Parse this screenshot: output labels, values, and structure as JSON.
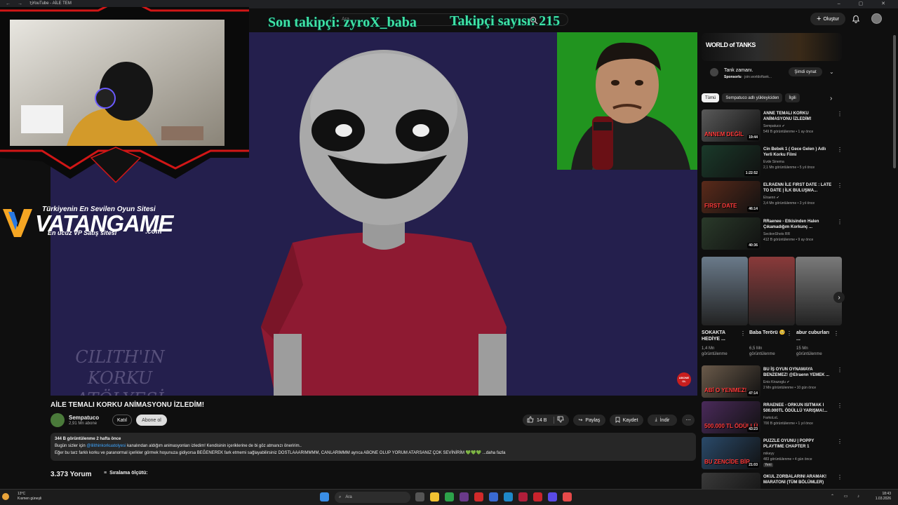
{
  "browser": {
    "tab_title": "YouTube - AİLE TEM",
    "nav_glyphs": "← → ↻",
    "window_glyphs": "– ▢ ✕"
  },
  "header": {
    "search_placeholder": "Ara",
    "create_label": "Oluştur"
  },
  "overlay": {
    "last_follower": "Son takipçi: zyroX_baba",
    "follower_count": "Takipçi sayısı: 215",
    "watermark_line1": "CILITH'IN KORKU",
    "watermark_line2": "ATÖLYESİ",
    "abone_label": "ABONE OL"
  },
  "sponsor": {
    "tagline": "Türkiyenin En Sevilen Oyun Sitesi",
    "name_part1": "VATAN",
    "name_part2": "GAME",
    "subline": "En ucuz VP Satış sitesi",
    "domain": ".com"
  },
  "video": {
    "title": "AİLE TEMALI KORKU ANİMASYONU İZLEDİM!",
    "channel": "Sempatuco",
    "subscribers": "2,91 Mn abone",
    "join_label": "Katıl",
    "subscribe_label": "Abone ol",
    "likes": "14 B",
    "share_label": "Paylaş",
    "save_label": "Kaydet",
    "download_label": "İndir",
    "more_glyph": "⋯"
  },
  "description": {
    "meta": "344 B görüntülenme  2 hafta önce",
    "line1_pre": "Bugün sizler için ",
    "line1_link": "@lilithinkorkuatolyesi",
    "line1_post": " kanalından aldığım animasyonları izledim! Kendisinin içeriklerine de bi göz atmanızı öneririm..",
    "line2": "Eğer bu tarz farklı korku ve paranormal içerikler görmek hoşunuza gidiyorsa BEĞENEREK fark etmemi sağlayabilirsiniz DOSTLAAARIMMMM, CANLARIMMM ayrıca ABONE OLUP YORUM ATARSANIZ ÇOK SEVİNİRİM 💚💚💚 ...daha fazla"
  },
  "comments": {
    "count": "3.373 Yorum",
    "sort_label": "Sıralama ölçütü:"
  },
  "ad": {
    "brand": "WORLD of TANKS",
    "title": "Tank zamanı.",
    "sponsor_label": "Sponsorlu",
    "sponsor_url": "· join.worldoftank...",
    "cta": "Şimdi oynat"
  },
  "chips": [
    "Tümü",
    "Sempatuco adlı yükleyiciden",
    "İlgili"
  ],
  "recommendations": [
    {
      "title": "ANNE TEMALI KORKU ANİMASYONU İZLEDİM!",
      "channel": "Sempatuco ✔",
      "views": "549 B görüntülenme • 1 ay önce",
      "duration": "19:44",
      "thumb_text": "ANNEM DEĞİL",
      "color": "#5a5a5a"
    },
    {
      "title": "Cin Bebek 1 ( Gece Gelen ) Adlı Yerli Korku Filmi",
      "channel": "Evde Sinema",
      "views": "2,1 Mn görüntülenme • 5 yıl önce",
      "duration": "1:22:52",
      "thumb_text": "",
      "color": "#1a3a2a"
    },
    {
      "title": "ELRAENN İLE FIRST DATE : LATE TO DATE | İLK BULUŞMA...",
      "channel": "Elraenn ✔",
      "views": "3,4 Mn görüntülenme • 3 yıl önce",
      "duration": "46:14",
      "thumb_text": "FIRST DATE",
      "color": "#5a2a1a"
    },
    {
      "title": "RRaenee - Etkisinden Halen Çıkamadığım Korkunç ...",
      "channel": "SectionShots RR",
      "views": "412 B görüntülenme • 9 ay önce",
      "duration": "40:36",
      "thumb_text": "",
      "color": "#2a3a2a"
    }
  ],
  "shorts": [
    {
      "title": "SOKAKTA HEDİYE ...",
      "views": "1,4 Mn görüntülenme",
      "color": "#6a7a8a"
    },
    {
      "title": "Baba Terörü 🥺",
      "views": "6,5 Mn görüntülenme",
      "color": "#8a3a3a"
    },
    {
      "title": "abur cuburları ...",
      "views": "15 Mn görüntülenme",
      "color": "#7a7a7a"
    }
  ],
  "recommendations2": [
    {
      "title": "BU İŞ OYUN OYNAMAYA BENZEMEZ! @Elraenn YEMEK ...",
      "channel": "Enis Kirazoglu ✔",
      "views": "2 Mn görüntülenme • 10 gün önce",
      "duration": "47:14",
      "thumb_text": "ABİ O YENMEZ!",
      "color": "#6a5a4a"
    },
    {
      "title": "RRAENEE - ORKUN ISITMAK I 500.000TL ÖDÜLLÜ YARIŞMA!...",
      "channel": "FarkoLoL",
      "views": "700 B görüntülenme • 1 yıl önce",
      "duration": "43:23",
      "thumb_text": "500.000 TL ÖDÜLLÜ",
      "color": "#4a2a5a"
    },
    {
      "title": "PUZZLE OYUNU | POPPY PLAYTIME CHAPTER 1",
      "channel": "mikeyy",
      "views": "483 görüntülenme • 4 gün önce",
      "duration": "21:03",
      "thumb_text": "BU ZENCİDE BİR",
      "color": "#2a4a6a",
      "badge": "Yeni"
    },
    {
      "title": "OKUL ZORBALARINI ARAMAK! MARATONI (TÜM BÖLÜMLER)",
      "channel": "",
      "views": "",
      "duration": "",
      "thumb_text": "",
      "color": "#3a3a3a"
    }
  ],
  "taskbar": {
    "temp": "13°C",
    "weather": "Kısmen güneşli",
    "search": "Ara",
    "time": "18:43",
    "date": "1.03.2026"
  }
}
